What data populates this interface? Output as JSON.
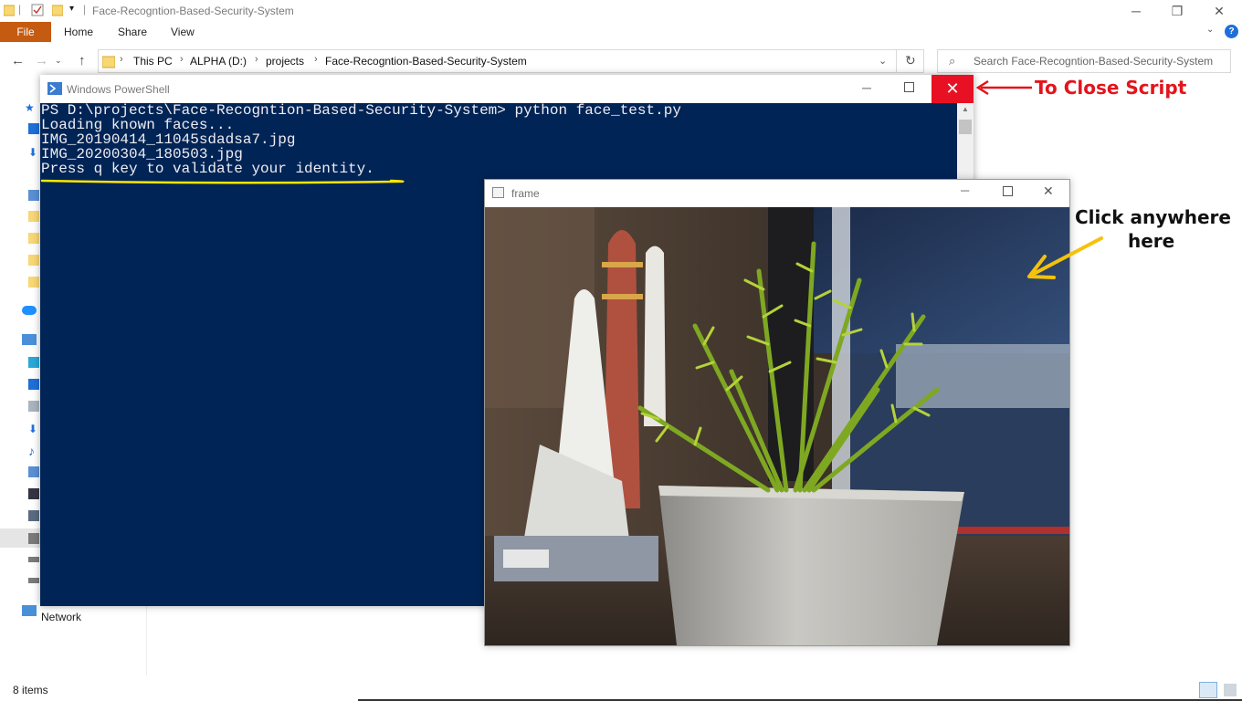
{
  "explorer": {
    "title": "Face-Recogntion-Based-Security-System",
    "ribbon": {
      "file": "File",
      "home": "Home",
      "share": "Share",
      "view": "View"
    },
    "breadcrumbs": [
      "This PC",
      "ALPHA (D:)",
      "projects",
      "Face-Recogntion-Based-Security-System"
    ],
    "search_placeholder": "Search Face-Recogntion-Based-Security-System",
    "sidebar": {
      "network": "Network"
    },
    "status": {
      "items": "8 items"
    }
  },
  "powershell": {
    "title": "Windows PowerShell",
    "lines": [
      "PS D:\\projects\\Face-Recogntion-Based-Security-System> python face_test.py",
      "Loading known faces...",
      "IMG_20190414_11045sdadsa7.jpg",
      "IMG_20200304_180503.jpg",
      "Press q key to validate your identity."
    ]
  },
  "frame": {
    "title": "frame"
  },
  "annotations": {
    "close_script": "To Close Script",
    "click_line1": "Click anywhere",
    "click_line2": "here"
  },
  "colors": {
    "file_tab": "#c55a11",
    "ps_background": "#012456",
    "close_red": "#e81123",
    "annotation_red": "#e3141c",
    "underline_yellow": "#ffe600",
    "arrow_yellow": "#f5c20b"
  }
}
